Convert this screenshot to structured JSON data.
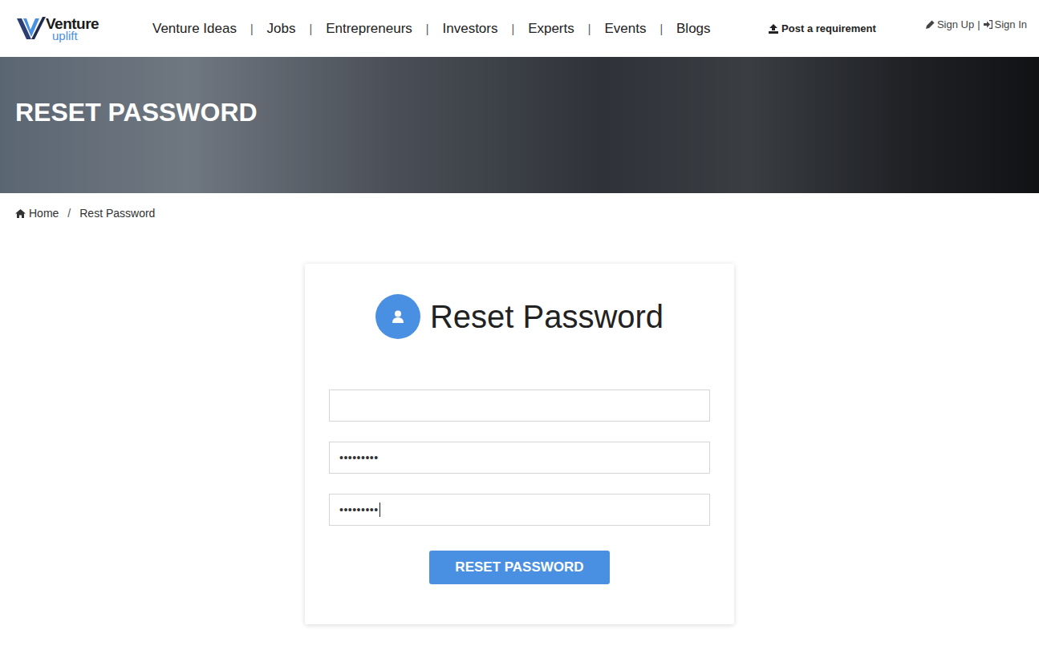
{
  "header": {
    "logo": {
      "name": "Venture",
      "tagline": "uplift"
    },
    "nav": [
      "Venture Ideas",
      "Jobs",
      "Entrepreneurs",
      "Investors",
      "Experts",
      "Events",
      "Blogs"
    ],
    "separator": "|",
    "post_requirement": "Post a requirement",
    "auth": {
      "sign_up": "Sign Up",
      "separator": "|",
      "sign_in": "Sign In"
    }
  },
  "banner": {
    "title": "RESET PASSWORD"
  },
  "breadcrumb": {
    "items": [
      "Home",
      "Rest Password"
    ],
    "separator": "/"
  },
  "form": {
    "title": "Reset Password",
    "fields": [
      {
        "kind": "text",
        "value": "",
        "focused": false
      },
      {
        "kind": "password",
        "value": "•••••••••",
        "focused": false
      },
      {
        "kind": "password",
        "value": "•••••••••",
        "focused": true
      }
    ],
    "button": "RESET PASSWORD"
  }
}
